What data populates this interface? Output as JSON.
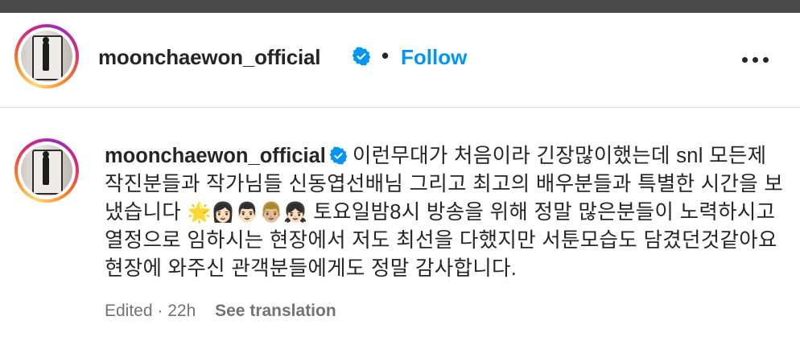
{
  "post": {
    "username": "moonchaewon_official",
    "dot_separator": "•",
    "follow_label": "Follow",
    "more_icon": "more-horizontal-icon",
    "verified_icon": "verified-badge-icon",
    "colors": {
      "follow": "#0095f6",
      "verified": "#0095f6",
      "text": "#262626",
      "meta": "#737373"
    }
  },
  "caption": {
    "username": "moonchaewon_official",
    "text_part1": "이런무대가 처음이라 긴장많이했는데 snl 모든제작진분들과 작가님들 신동엽선배님 그리고 최고의 배우분들과 특별한 시간을 보냈습니다 ",
    "emojis": "🌟👩🏻👨🏻👨🏼👧🏻",
    "text_part2": " 토요일밤8시 방송을 위해 정말 많은분들이 노력하시고 열정으로 임하시는 현장에서 저도 최선을 다했지만 서툰모습도 담겼던것같아요 현장에 와주신 관객분들에게도 정말 감사합니다."
  },
  "meta": {
    "edited": "Edited",
    "separator": "·",
    "time": "22h",
    "see_translation": "See translation"
  }
}
